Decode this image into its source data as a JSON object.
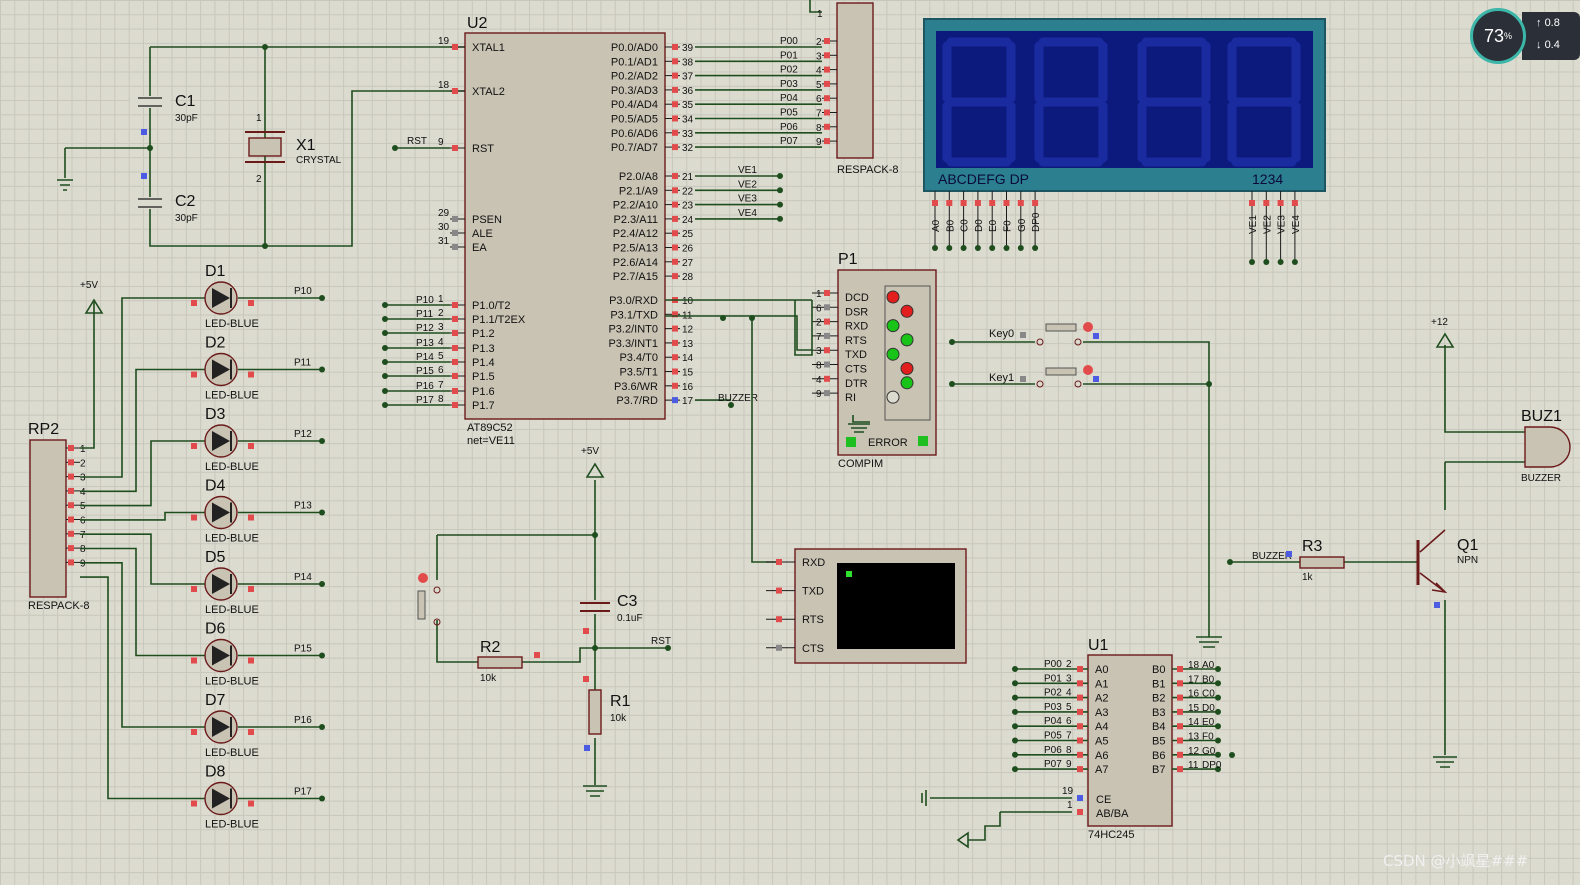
{
  "u2": {
    "ref": "U2",
    "part": "AT89C52",
    "net": "net=VE11",
    "left_pins": [
      {
        "num": "19",
        "name": "XTAL1"
      },
      {
        "num": "18",
        "name": "XTAL2"
      },
      {
        "num": "9",
        "name": "RST"
      },
      {
        "num": "29",
        "name": "PSEN"
      },
      {
        "num": "30",
        "name": "ALE"
      },
      {
        "num": "31",
        "name": "EA"
      },
      {
        "num": "1",
        "name": "P1.0/T2"
      },
      {
        "num": "2",
        "name": "P1.1/T2EX"
      },
      {
        "num": "3",
        "name": "P1.2"
      },
      {
        "num": "4",
        "name": "P1.3"
      },
      {
        "num": "5",
        "name": "P1.4"
      },
      {
        "num": "6",
        "name": "P1.5"
      },
      {
        "num": "7",
        "name": "P1.6"
      },
      {
        "num": "8",
        "name": "P1.7"
      }
    ],
    "right_pins": [
      {
        "num": "39",
        "name": "P0.0/AD0"
      },
      {
        "num": "38",
        "name": "P0.1/AD1"
      },
      {
        "num": "37",
        "name": "P0.2/AD2"
      },
      {
        "num": "36",
        "name": "P0.3/AD3"
      },
      {
        "num": "35",
        "name": "P0.4/AD4"
      },
      {
        "num": "34",
        "name": "P0.5/AD5"
      },
      {
        "num": "33",
        "name": "P0.6/AD6"
      },
      {
        "num": "32",
        "name": "P0.7/AD7"
      },
      {
        "num": "21",
        "name": "P2.0/A8"
      },
      {
        "num": "22",
        "name": "P2.1/A9"
      },
      {
        "num": "23",
        "name": "P2.2/A10"
      },
      {
        "num": "24",
        "name": "P2.3/A11"
      },
      {
        "num": "25",
        "name": "P2.4/A12"
      },
      {
        "num": "26",
        "name": "P2.5/A13"
      },
      {
        "num": "27",
        "name": "P2.6/A14"
      },
      {
        "num": "28",
        "name": "P2.7/A15"
      },
      {
        "num": "10",
        "name": "P3.0/RXD"
      },
      {
        "num": "11",
        "name": "P3.1/TXD"
      },
      {
        "num": "12",
        "name": "P3.2/INT0"
      },
      {
        "num": "13",
        "name": "P3.3/INT1"
      },
      {
        "num": "14",
        "name": "P3.4/T0"
      },
      {
        "num": "15",
        "name": "P3.5/T1"
      },
      {
        "num": "16",
        "name": "P3.6/WR"
      },
      {
        "num": "17",
        "name": "P3.7/RD"
      }
    ],
    "p0_nets": [
      "P00",
      "P01",
      "P02",
      "P03",
      "P04",
      "P05",
      "P06",
      "P07"
    ],
    "p2_nets": [
      "VE1",
      "VE2",
      "VE3",
      "VE4"
    ],
    "p1_nets": [
      "P10",
      "P11",
      "P12",
      "P13",
      "P14",
      "P15",
      "P16",
      "P17"
    ],
    "buzzer_net": "BUZZER",
    "rst_net": "RST"
  },
  "crystal": {
    "c1": "C1",
    "c1v": "30pF",
    "c2": "C2",
    "c2v": "30pF",
    "x1": "X1",
    "x1v": "CRYSTAL",
    "pin1": "1",
    "pin2": "2"
  },
  "rp1": {
    "part": "RESPACK-8",
    "pin1": "1",
    "pins": [
      "2",
      "3",
      "4",
      "5",
      "6",
      "7",
      "8",
      "9"
    ]
  },
  "rp2": {
    "ref": "RP2",
    "part": "RESPACK-8",
    "pins": [
      "1",
      "2",
      "3",
      "4",
      "5",
      "6",
      "7",
      "8",
      "9"
    ],
    "vcc": "+5V"
  },
  "leds": {
    "part": "LED-BLUE",
    "items": [
      {
        "ref": "D1",
        "net": "P10"
      },
      {
        "ref": "D2",
        "net": "P11"
      },
      {
        "ref": "D3",
        "net": "P12"
      },
      {
        "ref": "D4",
        "net": "P13"
      },
      {
        "ref": "D5",
        "net": "P14"
      },
      {
        "ref": "D6",
        "net": "P15"
      },
      {
        "ref": "D7",
        "net": "P16"
      },
      {
        "ref": "D8",
        "net": "P17"
      }
    ]
  },
  "display": {
    "seg_label": "ABCDEFG  DP",
    "digit_label": "1234",
    "seg_pins": [
      "A0",
      "B0",
      "C0",
      "D0",
      "E0",
      "F0",
      "G0",
      "DP0"
    ],
    "digit_pins": [
      "VE1",
      "VE2",
      "VE3",
      "VE4"
    ]
  },
  "compim": {
    "ref": "P1",
    "part": "COMPIM",
    "error": "ERROR",
    "pins": [
      {
        "num": "1",
        "name": "DCD"
      },
      {
        "num": "6",
        "name": "DSR"
      },
      {
        "num": "2",
        "name": "RXD"
      },
      {
        "num": "7",
        "name": "RTS"
      },
      {
        "num": "3",
        "name": "TXD"
      },
      {
        "num": "8",
        "name": "CTS"
      },
      {
        "num": "4",
        "name": "DTR"
      },
      {
        "num": "9",
        "name": "RI"
      }
    ]
  },
  "keys": {
    "k0": "Key0",
    "k1": "Key1"
  },
  "terminal": {
    "pins": [
      "RXD",
      "TXD",
      "RTS",
      "CTS"
    ]
  },
  "reset": {
    "vcc": "+5V",
    "c3": "C3",
    "c3v": "0.1uF",
    "r2": "R2",
    "r2v": "10k",
    "r1": "R1",
    "r1v": "10k",
    "rst": "RST"
  },
  "u1": {
    "ref": "U1",
    "part": "74HC245",
    "a_pins": [
      {
        "num": "2",
        "name": "A0",
        "net": "P00"
      },
      {
        "num": "3",
        "name": "A1",
        "net": "P01"
      },
      {
        "num": "4",
        "name": "A2",
        "net": "P02"
      },
      {
        "num": "5",
        "name": "A3",
        "net": "P03"
      },
      {
        "num": "6",
        "name": "A4",
        "net": "P04"
      },
      {
        "num": "7",
        "name": "A5",
        "net": "P05"
      },
      {
        "num": "8",
        "name": "A6",
        "net": "P06"
      },
      {
        "num": "9",
        "name": "A7",
        "net": "P07"
      }
    ],
    "b_pins": [
      {
        "num": "18",
        "name": "B0",
        "net": "A0"
      },
      {
        "num": "17",
        "name": "B1",
        "net": "B0"
      },
      {
        "num": "16",
        "name": "B2",
        "net": "C0"
      },
      {
        "num": "15",
        "name": "B3",
        "net": "D0"
      },
      {
        "num": "14",
        "name": "B4",
        "net": "E0"
      },
      {
        "num": "13",
        "name": "B5",
        "net": "F0"
      },
      {
        "num": "12",
        "name": "B6",
        "net": "G0"
      },
      {
        "num": "11",
        "name": "B7",
        "net": "DP0"
      }
    ],
    "ce": "CE",
    "ce_num": "19",
    "dir": "AB/BA",
    "dir_num": "1"
  },
  "buzzer": {
    "ref": "BUZ1",
    "part": "BUZZER",
    "vcc": "+12",
    "r3": "R3",
    "r3v": "1k",
    "q1": "Q1",
    "q1v": "NPN",
    "net": "BUZZER"
  },
  "overlay": {
    "cpu": "73",
    "cpu_unit": "%",
    "up": "0.8",
    "down": "0.4",
    "watermark": "CSDN @小飒星###"
  }
}
